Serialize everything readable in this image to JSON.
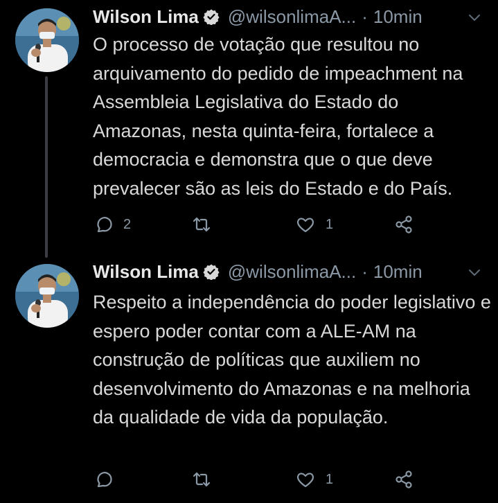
{
  "tweets": [
    {
      "author_name": "Wilson Lima",
      "handle": "@wilsonlimaA...",
      "separator": "·",
      "time": "10min",
      "text": "O processo de votação que resultou no arquivamento do pedido de impeachment na Assembleia Legislativa do Estado do Amazonas, nesta quinta-feira, fortalece a democracia e demonstra que o que deve prevalecer são as leis do Estado e do País.",
      "reply_count": "2",
      "retweet_count": "",
      "like_count": "1"
    },
    {
      "author_name": "Wilson Lima",
      "handle": "@wilsonlimaA...",
      "separator": "·",
      "time": "10min",
      "text": "Respeito a independência do poder legislativo e espero poder contar com a ALE-AM na construção de políticas que auxiliem no desenvolvimento do Amazonas e na melhoria da qualidade de vida da população.",
      "reply_count": "",
      "retweet_count": "",
      "like_count": "1"
    }
  ],
  "icons": {
    "verified": "verified-badge-icon",
    "caret": "chevron-down-icon",
    "reply": "reply-icon",
    "retweet": "retweet-icon",
    "like": "heart-icon",
    "share": "share-icon"
  },
  "colors": {
    "background": "#000000",
    "text": "#d9d9d9",
    "secondary_text": "#8b98a5",
    "thread_line": "#3a3d41"
  }
}
